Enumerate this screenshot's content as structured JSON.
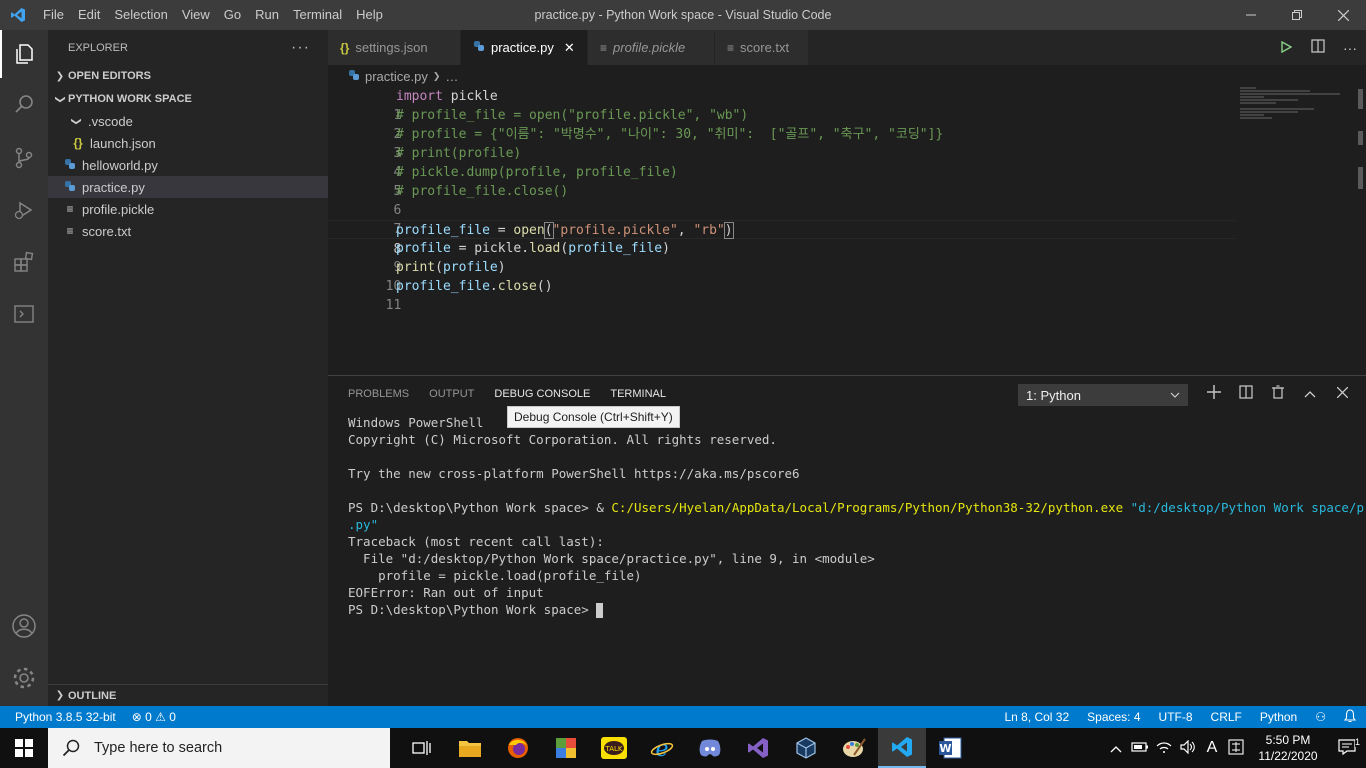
{
  "titlebar": {
    "menu": [
      "File",
      "Edit",
      "Selection",
      "View",
      "Go",
      "Run",
      "Terminal",
      "Help"
    ],
    "title": "practice.py - Python Work space - Visual Studio Code"
  },
  "sidebar": {
    "header": "EXPLORER",
    "more": "···",
    "open_editors": "OPEN EDITORS",
    "workspace": "PYTHON WORK SPACE",
    "items": [
      {
        "label": ".vscode"
      },
      {
        "label": "launch.json"
      },
      {
        "label": "helloworld.py"
      },
      {
        "label": "practice.py"
      },
      {
        "label": "profile.pickle"
      },
      {
        "label": "score.txt"
      }
    ],
    "outline": "OUTLINE"
  },
  "tabs": [
    {
      "label": "settings.json",
      "icon": "{}"
    },
    {
      "label": "practice.py",
      "icon": "py"
    },
    {
      "label": "profile.pickle",
      "icon": "≡"
    },
    {
      "label": "score.txt",
      "icon": "≡"
    }
  ],
  "breadcrumb": {
    "file": "practice.py",
    "rest": "…"
  },
  "editor": {
    "line_numbers": [
      "1",
      "2",
      "3",
      "4",
      "5",
      "6",
      "7",
      "8",
      "9",
      "10",
      "11"
    ],
    "lines": {
      "l1a": "import",
      "l1b": " pickle",
      "l2": "# profile_file = open(\"profile.pickle\", \"wb\")",
      "l3": "# profile = {\"이름\": \"박명수\", \"나이\": 30, \"취미\":  [\"골프\", \"축구\", \"코딩\"]}",
      "l4": "# print(profile)",
      "l5": "# pickle.dump(profile, profile_file)",
      "l6": "# profile_file.close()",
      "l8a": "profile_file",
      "l8b": " = ",
      "l8c": "open",
      "l8d": "(",
      "l8e": "\"profile.pickle\"",
      "l8f": ", ",
      "l8g": "\"rb\"",
      "l8h": ")",
      "l9a": "profile",
      "l9b": " = ",
      "l9c": "pickle",
      "l9d": ".",
      "l9e": "load",
      "l9f": "(",
      "l9g": "profile_file",
      "l9h": ")",
      "l10a": "print",
      "l10b": "(",
      "l10c": "profile",
      "l10d": ")",
      "l11a": "profile_file",
      "l11b": ".",
      "l11c": "close",
      "l11d": "()"
    }
  },
  "panel": {
    "tabs": [
      "PROBLEMS",
      "OUTPUT",
      "DEBUG CONSOLE",
      "TERMINAL"
    ],
    "terminal_select": "1: Python",
    "tooltip": "Debug Console (Ctrl+Shift+Y)",
    "terminal": {
      "t1": "Windows PowerShell",
      "t2": "Copyright (C) Microsoft Corporation. All rights reserved.",
      "t3": "Try the new cross-platform PowerShell https://aka.ms/pscore6",
      "t4a": "PS D:\\desktop\\Python Work space> & ",
      "t4b": "C:/Users/Hyelan/AppData/Local/Programs/Python/Python38-32/python.exe",
      "t4c": " \"d:/desktop/Python Work space/practice",
      "t5": ".py\"",
      "t6": "Traceback (most recent call last):",
      "t7": "  File \"d:/desktop/Python Work space/practice.py\", line 9, in <module>",
      "t8": "    profile = pickle.load(profile_file)",
      "t9": "EOFError: Ran out of input",
      "t10": "PS D:\\desktop\\Python Work space> "
    }
  },
  "statusbar": {
    "python": "Python 3.8.5 32-bit",
    "problems": "⊗ 0 ⚠ 0",
    "position": "Ln 8, Col 32",
    "spaces": "Spaces: 4",
    "encoding": "UTF-8",
    "eol": "CRLF",
    "language": "Python"
  },
  "taskbar": {
    "search_placeholder": "Type here to search",
    "time": "5:50 PM",
    "date": "11/22/2020",
    "lang": "A",
    "notif_count": "1"
  },
  "colors": {
    "accent": "#007acc",
    "title_bar": "#3c3c3c",
    "activity_bar": "#333333",
    "sidebar": "#252526",
    "editor": "#1e1e1e"
  }
}
